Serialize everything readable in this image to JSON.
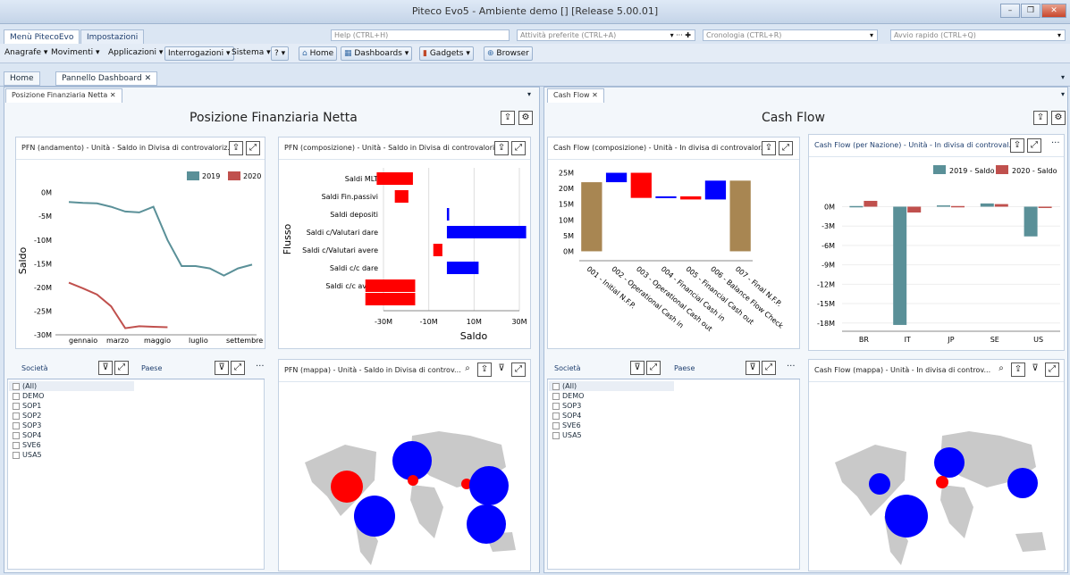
{
  "window": {
    "title": "Piteco Evo5 - Ambiente demo [] [Release 5.00.01]",
    "btn_min": "–",
    "btn_max": "❐",
    "btn_close": "✕"
  },
  "menu_tabs": [
    "Menù PitecoEvo",
    "Impostazioni"
  ],
  "top_inputs": {
    "help": "Help (CTRL+H)",
    "favorites": "Attività preferite (CTRL+A)",
    "history": "Cronologia (CTRL+R)",
    "quick": "Avvio rapido (CTRL+Q)"
  },
  "toolbar": {
    "anagrafe": "Anagrafe ▾",
    "movimenti": "Movimenti ▾",
    "applicazioni": "Applicazioni ▾",
    "interrogazioni": "Interrogazioni ▾",
    "sistema": "Sistema ▾",
    "help": "? ▾",
    "home": "Home",
    "dashboards": "Dashboards",
    "gadgets": "Gadgets",
    "browser": "Browser"
  },
  "doc_tabs": [
    "Home",
    "Pannello Dashboard"
  ],
  "left_subtab": "Posizione Finanziaria Netta",
  "right_subtab": "Cash Flow",
  "left_title": "Posizione Finanziaria Netta",
  "right_title": "Cash Flow",
  "pfn_andamento": {
    "header": "PFN (andamento) - Unità - Saldo in Divisa di controvaloriz...",
    "chart_data": {
      "type": "line",
      "title": "",
      "ylabel": "Saldo",
      "xlabel": "",
      "ylim": [
        -30,
        2
      ],
      "x_ticks": [
        "gennaio",
        "marzo",
        "maggio",
        "luglio",
        "settembre"
      ],
      "yticks": [
        "0M",
        "-5M",
        "-10M",
        "-15M",
        "-20M",
        "-25M",
        "-30M"
      ],
      "series": [
        {
          "name": "2019",
          "color": "#5a9098",
          "values": [
            -2,
            -2.2,
            -2.3,
            -3,
            -4,
            -4.2,
            -3,
            -10,
            -15.5,
            -15.5,
            -16,
            -17.5,
            -16,
            -15.2
          ]
        },
        {
          "name": "2020",
          "color": "#c0504d",
          "values": [
            -19,
            -20.2,
            -21.5,
            -24,
            -28.6,
            -28.2,
            -28.3,
            -28.4
          ]
        }
      ]
    }
  },
  "pfn_composizione": {
    "header": "PFN (composizione) - Unità - Saldo in Divisa di controvalori...",
    "chart_data": {
      "type": "bar",
      "orientation": "horizontal",
      "xlabel": "Saldo",
      "ylabel": "Flusso",
      "xlim": [
        -30,
        30
      ],
      "xticks": [
        "-30M",
        "-10M",
        "10M",
        "30M"
      ],
      "categories": [
        "Saldi MLT",
        "Saldi Fin.passivi",
        "Saldi depositi",
        "Saldi c/Valutari dare",
        "Saldi c/Valutari avere",
        "Saldi c/c dare",
        "Saldi c/c avere"
      ],
      "bars": [
        [
          -33,
          -17
        ],
        [
          -25,
          -19
        ],
        [
          -2,
          -1
        ],
        [
          -2,
          33
        ],
        [
          -8,
          -4
        ],
        [
          -2,
          12
        ],
        [
          -38,
          -16
        ]
      ],
      "extra_bar": [
        -38,
        -16
      ],
      "colors": [
        "#ff0000",
        "#ff0000",
        "#0000ff",
        "#0000ff",
        "#ff0000",
        "#0000ff",
        "#ff0000"
      ]
    }
  },
  "cf_composizione": {
    "header": "Cash Flow (composizione) - Unità - In divisa di controvalor...",
    "chart_data": {
      "type": "bar",
      "subtype": "waterfall",
      "ylim": [
        -3,
        26
      ],
      "yticks": [
        "25M",
        "20M",
        "15M",
        "10M",
        "5M",
        "0M"
      ],
      "categories": [
        "001 - Initial N.F.P.",
        "002 - Operational Cash in",
        "003 - Operational Cash out",
        "004 - Financial Cash in",
        "005 - Financial Cash out",
        "006 - Balance Flow Check",
        "007 - Final N.F.P."
      ],
      "ranges": [
        [
          0,
          22
        ],
        [
          22,
          25
        ],
        [
          17,
          25
        ],
        [
          17,
          17.5
        ],
        [
          16.5,
          17.5
        ],
        [
          16.5,
          22.5
        ],
        [
          0,
          22.5
        ]
      ],
      "colors": [
        "#a88652",
        "#0000ff",
        "#ff0000",
        "#0000ff",
        "#ff0000",
        "#0000ff",
        "#a88652"
      ]
    }
  },
  "cf_nazione": {
    "header": "Cash Flow (per Nazione) - Unità - In divisa di controval...",
    "chart_data": {
      "type": "bar",
      "ylim": [
        -19,
        2
      ],
      "yticks": [
        "0M",
        "-3M",
        "-6M",
        "-9M",
        "-12M",
        "-15M",
        "-18M"
      ],
      "categories": [
        "BR",
        "IT",
        "JP",
        "SE",
        "US"
      ],
      "series": [
        {
          "name": "2019 - Saldo",
          "color": "#5a9098",
          "values": [
            0.1,
            -18.3,
            0.2,
            0.5,
            -4.6
          ]
        },
        {
          "name": "2020 - Saldo",
          "color": "#c0504d",
          "values": [
            0.9,
            -0.9,
            0.1,
            0.4,
            -0.1
          ]
        }
      ]
    }
  },
  "filters_left": {
    "societa": "Società",
    "paese": "Paese",
    "items": [
      "(All)",
      "DEMO",
      "SOP1",
      "SOP2",
      "SOP3",
      "SOP4",
      "SVE6",
      "USA5"
    ]
  },
  "filters_right": {
    "societa": "Società",
    "paese": "Paese",
    "items": [
      "(All)",
      "DEMO",
      "SOP3",
      "SOP4",
      "SVE6",
      "USA5"
    ]
  },
  "pfn_mappa": {
    "header": "PFN (mappa) - Unità - Saldo in Divisa di controv..."
  },
  "cf_mappa": {
    "header": "Cash Flow (mappa) - Unità - In divisa di controv..."
  },
  "more": "···"
}
